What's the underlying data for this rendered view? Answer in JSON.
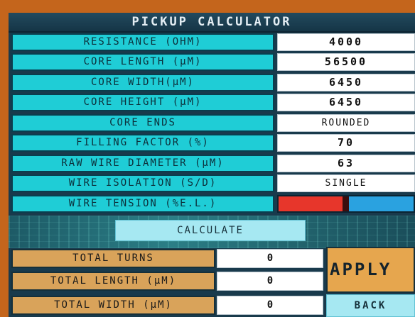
{
  "title": "PICKUP CALCULATOR",
  "inputs": [
    {
      "label": "RESISTANCE (OHM)",
      "value": "4000"
    },
    {
      "label": "CORE  LENGTH (µM)",
      "value": "56500"
    },
    {
      "label": "CORE WIDTH(µM)",
      "value": "6450"
    },
    {
      "label": "CORE HEIGHT (µM)",
      "value": "6450"
    },
    {
      "label": "CORE ENDS",
      "value": "ROUNDED"
    },
    {
      "label": "FILLING FACTOR (%)",
      "value": "70"
    },
    {
      "label": "RAW WIRE DIAMETER (µM)",
      "value": "63"
    },
    {
      "label": "WIRE ISOLATION (S/D)",
      "value": "SINGLE"
    }
  ],
  "tension": {
    "label": "WIRE TENSION (%E.L.)",
    "level": 0.5,
    "colors": {
      "fill": "#e7362b",
      "track": "#2aa2e0",
      "thumb": "#3a0e0e"
    }
  },
  "calculate_label": "CALCULATE",
  "outputs": [
    {
      "label": "TOTAL TURNS",
      "value": "0"
    },
    {
      "label": "TOTAL LENGTH (µM)",
      "value": "0"
    },
    {
      "label": "TOTAL WIDTH (µM)",
      "value": "0"
    }
  ],
  "apply_label": "APPLY",
  "back_label": "BACK",
  "colors": {
    "frame": "#c4651c",
    "panel": "#193a4c",
    "input_label": "#1fcdd6",
    "output_label": "#d9a35a",
    "apply": "#e6a64e",
    "button": "#a6e8f2"
  }
}
